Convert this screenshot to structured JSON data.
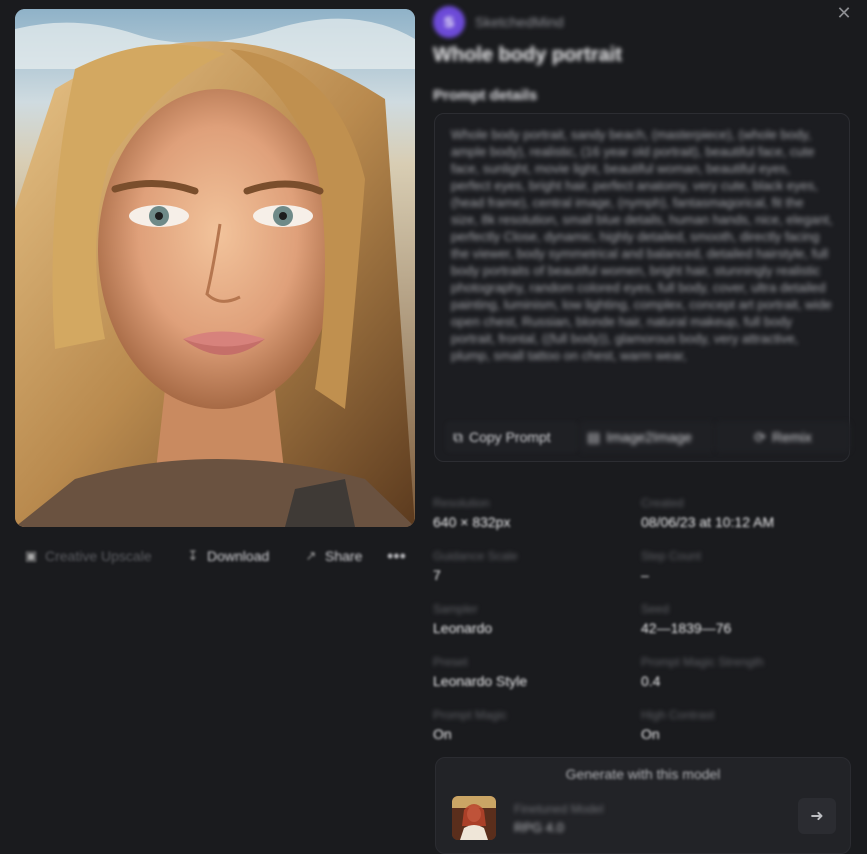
{
  "image": {
    "alt_icon": "portrait-image"
  },
  "actions": {
    "creative_upscale": "Creative Upscale",
    "download": "Download",
    "share": "Share",
    "more": "•••"
  },
  "user": {
    "avatar_letter": "S",
    "username": "SketchedMind"
  },
  "title": "Whole body portrait",
  "prompt": {
    "heading": "Prompt details",
    "text": "Whole body portrait, sandy beach, (masterpiece), (whole body, ample body), realistic, (16 year old portrait), beautiful face, cute face, sunlight, movie light, beautiful woman, beautiful eyes, perfect eyes, bright hair, perfect anatomy, very cute, black eyes, (head frame), central image, (nymph), fantasmagorical, fit the size, 8k resolution, small blue details, human hands, nice, elegant, perfectly Close, dynamic, highly detailed, smooth, directly facing the viewer, body symmetrical and balanced, detailed hairstyle, full body portraits of beautiful women, bright hair, stunningly realistic photography, random colored eyes, full body, cover, ultra detailed painting, luminism, low lighting, complex, concept art portrait, wide open chest, Russian, blonde hair, natural makeup, full body portrait, frontal, ((full body)), glamorous body, very attractive, plump, small tattoo on chest, warm wear,",
    "copy_label": "Copy Prompt",
    "img2img_label": "Image2Image",
    "remix_label": "Remix"
  },
  "meta": [
    {
      "label": "Resolution",
      "value": "640 × 832px"
    },
    {
      "label": "Created",
      "value": "08/06/23 at 10:12 AM"
    },
    {
      "label": "Guidance Scale",
      "value": "7"
    },
    {
      "label": "Step Count",
      "value": "–"
    },
    {
      "label": "Sampler",
      "value": "Leonardo"
    },
    {
      "label": "Seed",
      "value": "42—1839—76"
    },
    {
      "label": "Preset",
      "value": "Leonardo Style"
    },
    {
      "label": "Prompt Magic Strength",
      "value": "0.4"
    },
    {
      "label": "Prompt Magic",
      "value": "On"
    },
    {
      "label": "High Contrast",
      "value": "On"
    }
  ],
  "generate": {
    "title": "Generate with this model",
    "model_kind": "Finetuned Model",
    "model_name": "RPG 4.0",
    "go_icon": "arrow-right-icon"
  },
  "colors": {
    "background": "#1a1b1e",
    "avatar": "#6d4bd8"
  }
}
